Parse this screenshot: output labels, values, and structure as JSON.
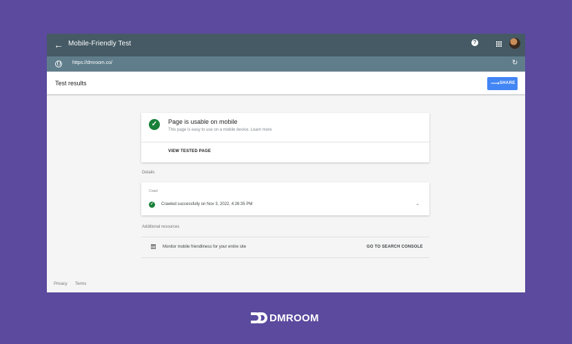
{
  "app": {
    "title": "Mobile-Friendly Test",
    "back_icon": "arrow-back-icon",
    "help_icon": "help-icon",
    "apps_icon": "apps-grid-icon"
  },
  "url_bar": {
    "url": "https://dmroom.co/",
    "globe_icon": "globe-icon",
    "reload_icon": "reload-icon"
  },
  "results_bar": {
    "label": "Test results",
    "share_label": "SHARE"
  },
  "result_card": {
    "heading": "Page is usable on mobile",
    "subtext": "This page is easy to use on a mobile device. Learn more",
    "link": "VIEW TESTED PAGE",
    "status_color": "#188038"
  },
  "details": {
    "section_title": "Details",
    "crawl_label": "Crawl",
    "crawl_status": "Crawled successfully on Nov 3, 2022, 4:26:35 PM"
  },
  "resources": {
    "section_title": "Additional resources",
    "message": "Monitor mobile friendliness for your entire site",
    "action": "GO TO SEARCH CONSOLE"
  },
  "footer": {
    "privacy": "Privacy",
    "terms": "Terms"
  },
  "brand": {
    "name": "DMROOM",
    "accent": "#5b4a9e"
  }
}
